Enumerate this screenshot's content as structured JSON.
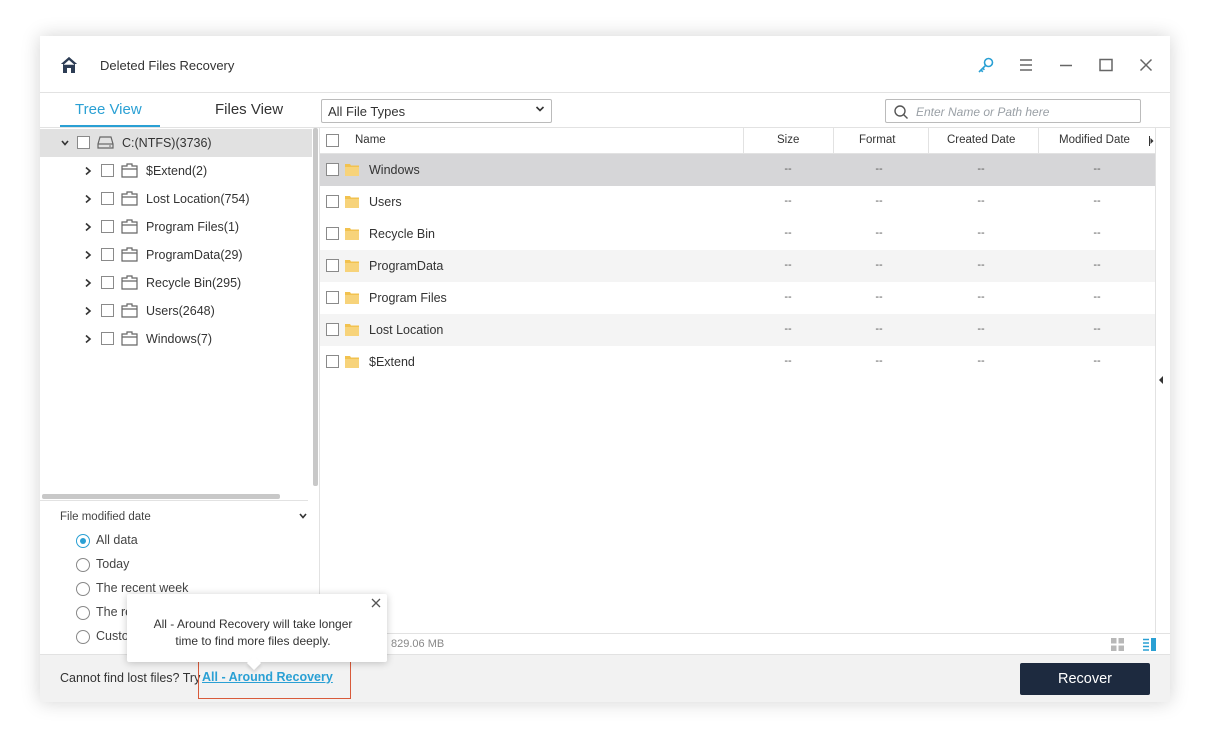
{
  "app": {
    "title": "Deleted Files Recovery"
  },
  "title_icons": [
    "key-icon",
    "menu-icon",
    "minimize-icon",
    "maximize-icon",
    "close-icon"
  ],
  "tabs": [
    {
      "label": "Tree View",
      "active": true
    },
    {
      "label": "Files View",
      "active": false
    }
  ],
  "filter": {
    "file_type": "All File Types",
    "search_placeholder": "Enter Name or Path here"
  },
  "tree": {
    "root": "C:(NTFS)(3736)",
    "children": [
      "$Extend(2)",
      "Lost Location(754)",
      "Program Files(1)",
      "ProgramData(29)",
      "Recycle Bin(295)",
      "Users(2648)",
      "Windows(7)"
    ]
  },
  "date_filter": {
    "title": "File modified date",
    "options": [
      {
        "label": "All data",
        "selected": true
      },
      {
        "label": "Today",
        "selected": false
      },
      {
        "label": "The recent week",
        "selected": false
      },
      {
        "label": "The re",
        "selected": false
      },
      {
        "label": "Custo",
        "selected": false
      }
    ]
  },
  "table": {
    "columns": [
      "Name",
      "Size",
      "Format",
      "Created Date",
      "Modified Date"
    ],
    "rows": [
      {
        "name": "Windows",
        "size": "--",
        "format": "--",
        "created": "--",
        "modified": "--"
      },
      {
        "name": "Users",
        "size": "--",
        "format": "--",
        "created": "--",
        "modified": "--"
      },
      {
        "name": "Recycle Bin",
        "size": "--",
        "format": "--",
        "created": "--",
        "modified": "--"
      },
      {
        "name": "ProgramData",
        "size": "--",
        "format": "--",
        "created": "--",
        "modified": "--"
      },
      {
        "name": "Program Files",
        "size": "--",
        "format": "--",
        "created": "--",
        "modified": "--"
      },
      {
        "name": "Lost Location",
        "size": "--",
        "format": "--",
        "created": "--",
        "modified": "--"
      },
      {
        "name": "$Extend",
        "size": "--",
        "format": "--",
        "created": "--",
        "modified": "--"
      }
    ]
  },
  "status": {
    "size_text": "829.06 MB"
  },
  "tooltip": {
    "text": "All - Around Recovery will take longer time to find more files deeply."
  },
  "bottom": {
    "prompt": "Cannot find lost files? Try",
    "link": "All - Around Recovery",
    "recover_label": "Recover"
  },
  "colors": {
    "accent": "#2aa0d4",
    "button_dark": "#1d2a3f",
    "highlight": "#d85a3a",
    "folder": "#f2c24f"
  }
}
